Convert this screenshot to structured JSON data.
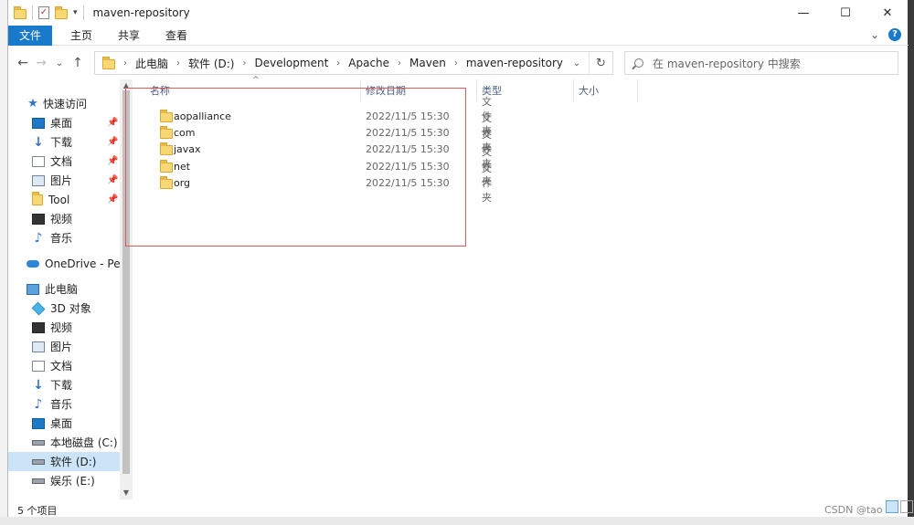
{
  "window": {
    "title": "maven-repository",
    "minimize": "—",
    "maximize": "☐",
    "close": "✕"
  },
  "ribbon": {
    "tabs": [
      "文件",
      "主页",
      "共享",
      "查看"
    ],
    "expand": "⌄",
    "help": "?"
  },
  "nav": {
    "back": "←",
    "forward": "→",
    "recent": "⌄",
    "up": "↑",
    "breadcrumb": [
      "此电脑",
      "软件 (D:)",
      "Development",
      "Apache",
      "Maven",
      "maven-repository"
    ],
    "search_placeholder": "在 maven-repository 中搜索"
  },
  "sidebar": {
    "quick_access": "快速访问",
    "quick_items": [
      {
        "label": "桌面",
        "icon": "desktop-icon",
        "pinned": true
      },
      {
        "label": "下载",
        "icon": "download-icon",
        "pinned": true
      },
      {
        "label": "文档",
        "icon": "document-icon",
        "pinned": true
      },
      {
        "label": "图片",
        "icon": "picture-icon",
        "pinned": true
      },
      {
        "label": "Tool",
        "icon": "folder-icon",
        "pinned": true
      },
      {
        "label": "视频",
        "icon": "video-icon",
        "pinned": false
      },
      {
        "label": "音乐",
        "icon": "music-icon",
        "pinned": false
      }
    ],
    "onedrive": "OneDrive - Perso",
    "this_pc": "此电脑",
    "pc_items": [
      {
        "label": "3D 对象",
        "icon": "3d-objects-icon"
      },
      {
        "label": "视频",
        "icon": "video-icon"
      },
      {
        "label": "图片",
        "icon": "picture-icon"
      },
      {
        "label": "文档",
        "icon": "document-icon"
      },
      {
        "label": "下载",
        "icon": "download-icon"
      },
      {
        "label": "音乐",
        "icon": "music-icon"
      },
      {
        "label": "桌面",
        "icon": "desktop-icon"
      },
      {
        "label": "本地磁盘 (C:)",
        "icon": "drive-icon"
      },
      {
        "label": "软件 (D:)",
        "icon": "drive-icon",
        "selected": true
      },
      {
        "label": "娱乐 (E:)",
        "icon": "drive-icon"
      }
    ]
  },
  "columns": [
    "名称",
    "修改日期",
    "类型",
    "大小"
  ],
  "files": [
    {
      "name": "aopalliance",
      "date": "2022/11/5 15:30",
      "type": "文件夹"
    },
    {
      "name": "com",
      "date": "2022/11/5 15:30",
      "type": "文件夹"
    },
    {
      "name": "javax",
      "date": "2022/11/5 15:30",
      "type": "文件夹"
    },
    {
      "name": "net",
      "date": "2022/11/5 15:30",
      "type": "文件夹"
    },
    {
      "name": "org",
      "date": "2022/11/5 15:30",
      "type": "文件夹"
    }
  ],
  "status": "5 个项目",
  "watermark": "CSDN @tao"
}
